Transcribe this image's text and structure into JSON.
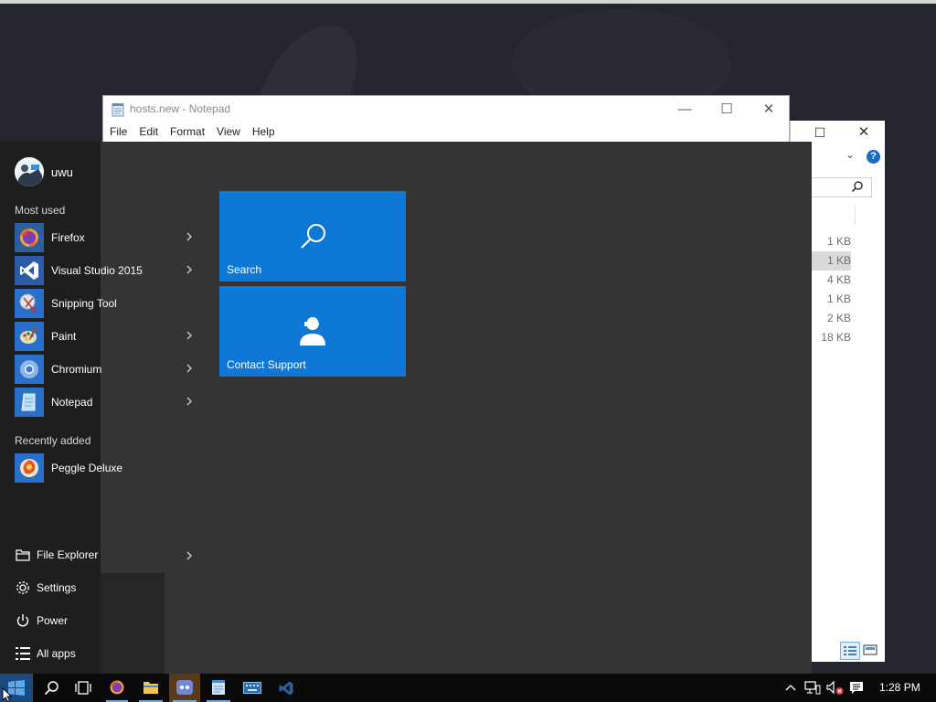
{
  "notepad": {
    "title": "hosts.new - Notepad",
    "menu": [
      "File",
      "Edit",
      "Format",
      "View",
      "Help"
    ],
    "minimize_glyph": "—",
    "maximize_glyph": "☐",
    "close_glyph": "✕"
  },
  "explorer": {
    "maximize_glyph": "☐",
    "close_glyph": "✕",
    "help_glyph": "?",
    "chevron_glyph": "⌄",
    "sizes": [
      "1 KB",
      "1 KB",
      "4 KB",
      "1 KB",
      "2 KB",
      "18 KB"
    ],
    "selected_size_index": 1
  },
  "start_menu": {
    "user_name": "uwu",
    "most_used_label": "Most used",
    "most_used": [
      {
        "label": "Firefox",
        "icon": "firefox-icon",
        "has_submenu": true
      },
      {
        "label": "Visual Studio 2015",
        "icon": "visual-studio-icon",
        "has_submenu": true
      },
      {
        "label": "Snipping Tool",
        "icon": "snipping-tool-icon",
        "has_submenu": false
      },
      {
        "label": "Paint",
        "icon": "paint-icon",
        "has_submenu": true
      },
      {
        "label": "Chromium",
        "icon": "chromium-icon",
        "has_submenu": true
      },
      {
        "label": "Notepad",
        "icon": "notepad-icon",
        "has_submenu": true
      }
    ],
    "recently_added_label": "Recently added",
    "recently_added": [
      {
        "label": "Peggle Deluxe",
        "icon": "peggle-icon"
      }
    ],
    "bottom": [
      {
        "label": "File Explorer",
        "icon": "file-explorer-icon",
        "has_submenu": true
      },
      {
        "label": "Settings",
        "icon": "gear-icon",
        "has_submenu": false
      },
      {
        "label": "Power",
        "icon": "power-icon",
        "has_submenu": false
      },
      {
        "label": "All apps",
        "icon": "all-apps-icon",
        "has_submenu": false
      }
    ],
    "tiles": [
      {
        "label": "Search",
        "icon": "search-icon"
      },
      {
        "label": "Contact Support",
        "icon": "contact-support-icon"
      }
    ]
  },
  "taskbar": {
    "clock": "1:28 PM",
    "pinned": [
      "windows-start-icon",
      "search-icon",
      "task-view-icon",
      "firefox-icon",
      "file-explorer-icon",
      "discord-icon",
      "notepad-icon",
      "keyboard-icon",
      "visual-studio-icon"
    ]
  },
  "colors": {
    "tile_blue": "#0e78d6",
    "start_bg": "#343434",
    "taskbar_bg": "#0a0a0a",
    "app_tile_blue": "#2a6fc9"
  }
}
